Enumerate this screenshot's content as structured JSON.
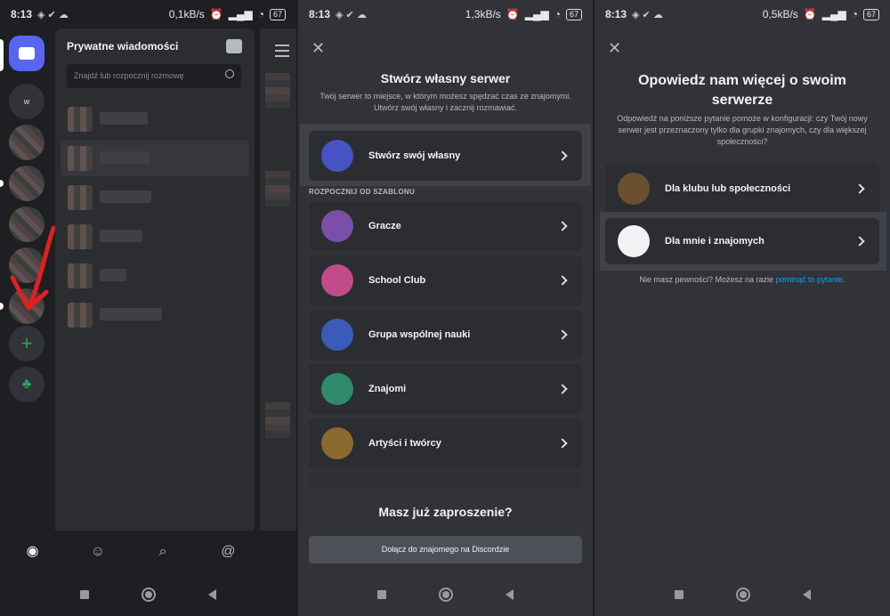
{
  "panels": [
    {
      "status": {
        "time": "8:13",
        "speed": "0,1kB/s",
        "battery": "67"
      },
      "dm": {
        "title": "Prywatne wiadomości",
        "search_placeholder": "Znajdź lub rozpocznij rozmowę"
      },
      "guilds": {
        "dm_icon": "discord-dm-icon",
        "server_label": "w",
        "add_icon": "plus-icon",
        "discover_icon": "discover-servers-icon"
      },
      "bottom_tabs": [
        "discord-home-icon",
        "friends-icon",
        "search-icon",
        "mentions-icon"
      ]
    },
    {
      "status": {
        "time": "8:13",
        "speed": "1,3kB/s",
        "battery": "67"
      },
      "title": "Stwórz własny serwer",
      "subtitle": "Twój serwer to miejsce, w którym możesz spędzać czas ze znajomymi. Utwórz swój własny i zacznij rozmawiać.",
      "create_own": "Stwórz swój własny",
      "section_header": "ROZPOCZNIJ OD SZABLONU",
      "templates": [
        "Gracze",
        "School Club",
        "Grupa wspólnej nauki",
        "Znajomi",
        "Artyści i twórcy"
      ],
      "invite_title": "Masz już zaproszenie?",
      "join_button": "Dołącz do znajomego na Discordzie"
    },
    {
      "status": {
        "time": "8:13",
        "speed": "0,5kB/s",
        "battery": "67"
      },
      "title": "Opowiedz nam więcej o swoim serwerze",
      "subtitle": "Odpowiedź na poniższe pytanie pomoże w konfiguracji: czy Twój nowy serwer jest przeznaczony tylko dla grupki znajomych, czy dla większej społeczności?",
      "options": [
        "Dla klubu lub społeczności",
        "Dla mnie i znajomych"
      ],
      "unsure_text": "Nie masz pewności? Możesz na razie",
      "skip_link": "pominąć to pytanie",
      "unsure_end": "."
    }
  ],
  "colors": {
    "blurple": "#5865f2",
    "green": "#23a55a",
    "link": "#00a8fc",
    "arrow": "#e02020"
  }
}
